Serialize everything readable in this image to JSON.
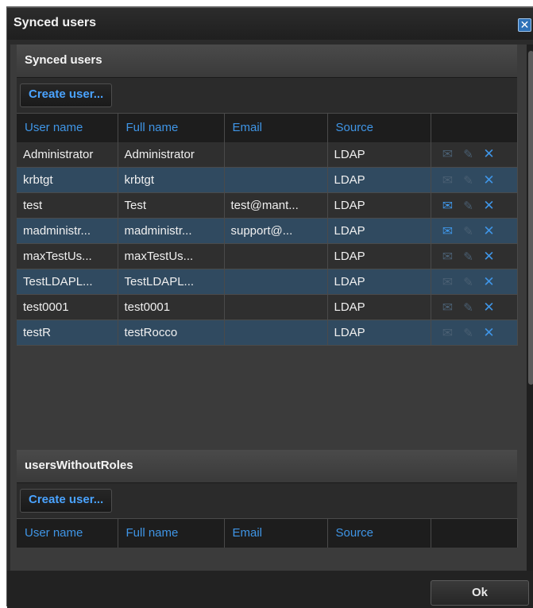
{
  "dialog": {
    "title": "Synced users",
    "close_icon": "close-icon",
    "ok_label": "Ok"
  },
  "synced_section": {
    "title": "Synced users",
    "create_label": "Create user...",
    "columns": [
      "User name",
      "Full name",
      "Email",
      "Source",
      ""
    ],
    "rows": [
      {
        "user": "Administrator",
        "full": "Administrator",
        "email": "",
        "source": "LDAP",
        "mail_enabled": false
      },
      {
        "user": "krbtgt",
        "full": "krbtgt",
        "email": "",
        "source": "LDAP",
        "mail_enabled": false
      },
      {
        "user": "test",
        "full": "Test",
        "email": "test@mant...",
        "source": "LDAP",
        "mail_enabled": true
      },
      {
        "user": "madministr...",
        "full": "madministr...",
        "email": "support@...",
        "source": "LDAP",
        "mail_enabled": true
      },
      {
        "user": "maxTestUs...",
        "full": "maxTestUs...",
        "email": "",
        "source": "LDAP",
        "mail_enabled": false
      },
      {
        "user": "TestLDAPL...",
        "full": "TestLDAPL...",
        "email": "",
        "source": "LDAP",
        "mail_enabled": false
      },
      {
        "user": "test0001",
        "full": "test0001",
        "email": "",
        "source": "LDAP",
        "mail_enabled": false
      },
      {
        "user": "testR",
        "full": "testRocco",
        "email": "",
        "source": "LDAP",
        "mail_enabled": false
      }
    ]
  },
  "roles_section": {
    "title": "usersWithoutRoles",
    "create_label": "Create user...",
    "columns": [
      "User name",
      "Full name",
      "Email",
      "Source",
      ""
    ]
  },
  "icons": {
    "mail": "send-mail-icon",
    "edit": "edit-pencil-icon",
    "delete": "delete-x-icon"
  },
  "colors": {
    "accent": "#3f95e6",
    "row_highlight": "#304a60",
    "row_plain": "#2f2f2f",
    "header_bg": "#1d1d1d"
  }
}
